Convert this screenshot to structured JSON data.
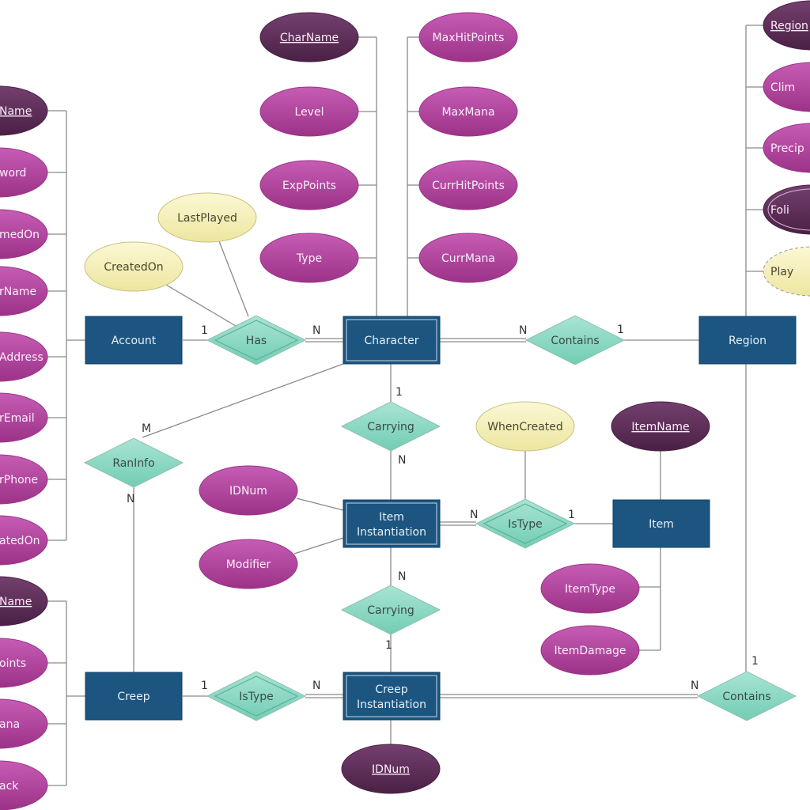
{
  "diagram": {
    "colors": {
      "entity": "#1b5580",
      "relationship": "#8fd8c4",
      "attribute": "#b0449a",
      "key_attribute": "#5a2a55",
      "derived_attribute": "#f5f0b8",
      "line": "#8a8a8a"
    },
    "entities": [
      {
        "id": "account",
        "label": "Account",
        "weak": false
      },
      {
        "id": "character",
        "label": "Character",
        "weak": true
      },
      {
        "id": "region",
        "label": "Region",
        "weak": false
      },
      {
        "id": "item_inst",
        "label": "Item Instantiation",
        "weak": true
      },
      {
        "id": "item",
        "label": "Item",
        "weak": false
      },
      {
        "id": "creep",
        "label": "Creep",
        "weak": false
      },
      {
        "id": "creep_inst",
        "label": "Creep Instantiation",
        "weak": true
      }
    ],
    "relationships": [
      {
        "id": "has",
        "label": "Has",
        "identifying": true
      },
      {
        "id": "contains1",
        "label": "Contains",
        "identifying": false
      },
      {
        "id": "carrying1",
        "label": "Carrying",
        "identifying": false
      },
      {
        "id": "raninfo",
        "label": "RanInfo",
        "identifying": false
      },
      {
        "id": "istype1",
        "label": "IsType",
        "identifying": true
      },
      {
        "id": "carrying2",
        "label": "Carrying",
        "identifying": false
      },
      {
        "id": "istype2",
        "label": "IsType",
        "identifying": true
      },
      {
        "id": "contains2",
        "label": "Contains",
        "identifying": false
      }
    ],
    "attributes": [
      {
        "id": "acc1",
        "label": "Name",
        "kind": "key"
      },
      {
        "id": "acc2",
        "label": "word",
        "kind": "normal"
      },
      {
        "id": "acc3",
        "label": "medOn",
        "kind": "normal"
      },
      {
        "id": "acc4",
        "label": "rName",
        "kind": "normal"
      },
      {
        "id": "acc5",
        "label": "Address",
        "kind": "normal"
      },
      {
        "id": "acc6",
        "label": "rEmail",
        "kind": "normal"
      },
      {
        "id": "acc7",
        "label": "rPhone",
        "kind": "normal"
      },
      {
        "id": "acc8",
        "label": "atedOn",
        "kind": "normal"
      },
      {
        "id": "cr1",
        "label": "Name",
        "kind": "key"
      },
      {
        "id": "cr2",
        "label": "oints",
        "kind": "normal"
      },
      {
        "id": "cr3",
        "label": "ana",
        "kind": "normal"
      },
      {
        "id": "cr4",
        "label": "ack",
        "kind": "normal"
      },
      {
        "id": "charname",
        "label": "CharName",
        "kind": "key"
      },
      {
        "id": "level",
        "label": "Level",
        "kind": "normal"
      },
      {
        "id": "exppoints",
        "label": "ExpPoints",
        "kind": "normal"
      },
      {
        "id": "type",
        "label": "Type",
        "kind": "normal"
      },
      {
        "id": "maxhp",
        "label": "MaxHitPoints",
        "kind": "normal"
      },
      {
        "id": "maxmana",
        "label": "MaxMana",
        "kind": "normal"
      },
      {
        "id": "currhp",
        "label": "CurrHitPoints",
        "kind": "normal"
      },
      {
        "id": "currmana",
        "label": "CurrMana",
        "kind": "normal"
      },
      {
        "id": "lastplayed",
        "label": "LastPlayed",
        "kind": "relationship"
      },
      {
        "id": "createdon",
        "label": "CreatedOn",
        "kind": "relationship"
      },
      {
        "id": "whencreated",
        "label": "WhenCreated",
        "kind": "relationship"
      },
      {
        "id": "idnum1",
        "label": "IDNum",
        "kind": "normal"
      },
      {
        "id": "modifier",
        "label": "Modifier",
        "kind": "normal"
      },
      {
        "id": "itemname",
        "label": "ItemName",
        "kind": "key"
      },
      {
        "id": "itemtype",
        "label": "ItemType",
        "kind": "normal"
      },
      {
        "id": "itemdamage",
        "label": "ItemDamage",
        "kind": "normal"
      },
      {
        "id": "idnum2",
        "label": "IDNum",
        "kind": "key"
      },
      {
        "id": "reg1",
        "label": "Region",
        "kind": "key"
      },
      {
        "id": "reg2",
        "label": "Clim",
        "kind": "normal"
      },
      {
        "id": "reg3",
        "label": "Precip",
        "kind": "normal"
      },
      {
        "id": "reg4",
        "label": "Foli",
        "kind": "multivalued"
      },
      {
        "id": "reg5",
        "label": "Play",
        "kind": "derived"
      }
    ],
    "cardinalities": [
      {
        "id": "c1",
        "label": "1"
      },
      {
        "id": "c2",
        "label": "N"
      },
      {
        "id": "c3",
        "label": "N"
      },
      {
        "id": "c4",
        "label": "1"
      },
      {
        "id": "c5",
        "label": "1"
      },
      {
        "id": "c6",
        "label": "N"
      },
      {
        "id": "c7",
        "label": "M"
      },
      {
        "id": "c8",
        "label": "N"
      },
      {
        "id": "c9",
        "label": "N"
      },
      {
        "id": "c10",
        "label": "1"
      },
      {
        "id": "c11",
        "label": "N"
      },
      {
        "id": "c12",
        "label": "1"
      },
      {
        "id": "c13",
        "label": "1"
      },
      {
        "id": "c14",
        "label": "N"
      },
      {
        "id": "c15",
        "label": "N"
      },
      {
        "id": "c16",
        "label": "1"
      }
    ]
  }
}
